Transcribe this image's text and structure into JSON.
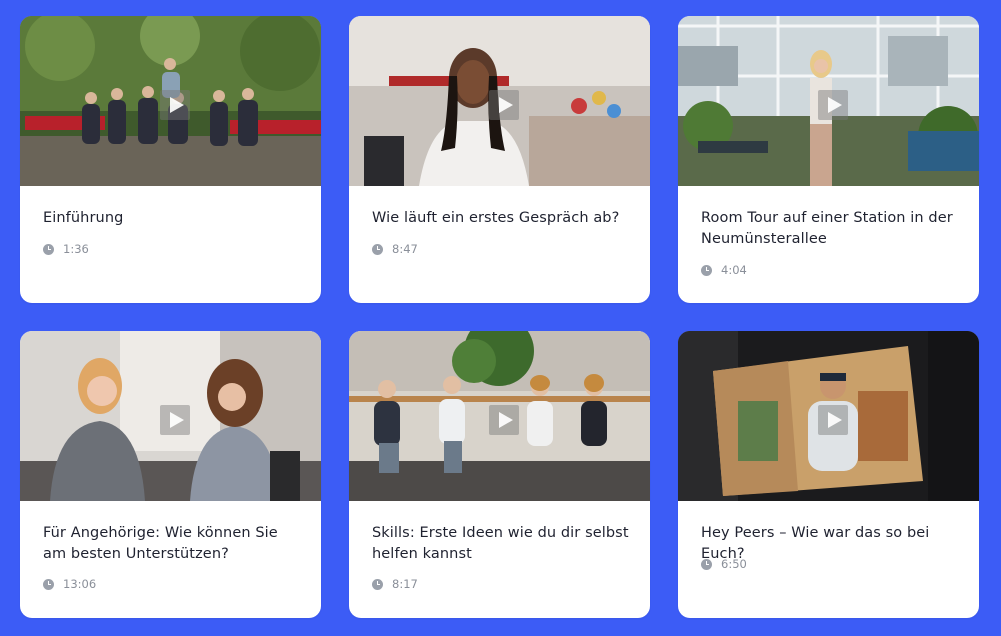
{
  "videos": [
    {
      "title": "Einführung",
      "duration": "1:36",
      "scene": "group-bench"
    },
    {
      "title": "Wie läuft ein erstes Gespräch ab?",
      "duration": "8:47",
      "scene": "girl-interview"
    },
    {
      "title": "Room Tour auf einer Station in der Neumünsterallee",
      "duration": "4:04",
      "scene": "terrace-tour"
    },
    {
      "title": "Für Angehörige: Wie können Sie am besten Unterstützen?",
      "duration": "13:06",
      "scene": "two-girls-talking"
    },
    {
      "title": "Skills: Erste Ideen wie du dir selbst helfen kannst",
      "duration": "8:17",
      "scene": "four-seated"
    },
    {
      "title": "Hey Peers – Wie war das so bei Euch?",
      "duration": "6:50",
      "scene": "camera-monitor"
    }
  ],
  "colors": {
    "background": "#3c5cf6",
    "card": "#ffffff",
    "title": "#1f2230",
    "meta": "#8a8f99"
  },
  "icons": {
    "play": "play-icon",
    "duration": "clock-icon"
  }
}
